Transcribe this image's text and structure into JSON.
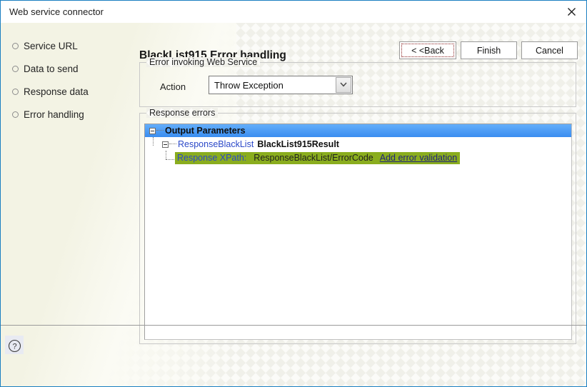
{
  "window": {
    "title": "Web service connector",
    "close_icon": "close-icon"
  },
  "sidebar": {
    "items": [
      {
        "label": "Service URL",
        "icon": "circle-bullet-icon"
      },
      {
        "label": "Data to send",
        "icon": "circle-bullet-icon"
      },
      {
        "label": "Response data",
        "icon": "circle-bullet-icon"
      },
      {
        "label": "Error handling",
        "icon": "circle-bullet-icon"
      }
    ]
  },
  "main": {
    "page_title": "BlackList915 Error handling",
    "error_invoking": {
      "legend": "Error invoking Web Service",
      "action_label": "Action",
      "action_value": "Throw Exception",
      "action_arrow_icon": "chevron-down-icon",
      "action_options": [
        "Throw Exception"
      ]
    },
    "response_errors": {
      "legend": "Response errors",
      "tree": {
        "root": {
          "label": "Output Parameters",
          "expander_icon": "collapse-minus-icon",
          "selected": true
        },
        "child": {
          "name": "ResponseBlackList",
          "type": "BlackList915Result",
          "expander_icon": "collapse-minus-icon"
        },
        "leaf": {
          "xpath_label": "Response XPath:",
          "xpath_value": "ResponseBlackList/ErrorCode",
          "action_link": "Add error validation"
        }
      }
    }
  },
  "footer": {
    "help_icon": "help-question-icon",
    "back_label": "< <Back",
    "finish_label": "Finish",
    "cancel_label": "Cancel"
  },
  "colors": {
    "accent_border": "#1a7fc1",
    "selection_blue": "#3a8df0",
    "highlight_green": "#8aad1e",
    "link_blue": "#2b48c8"
  }
}
